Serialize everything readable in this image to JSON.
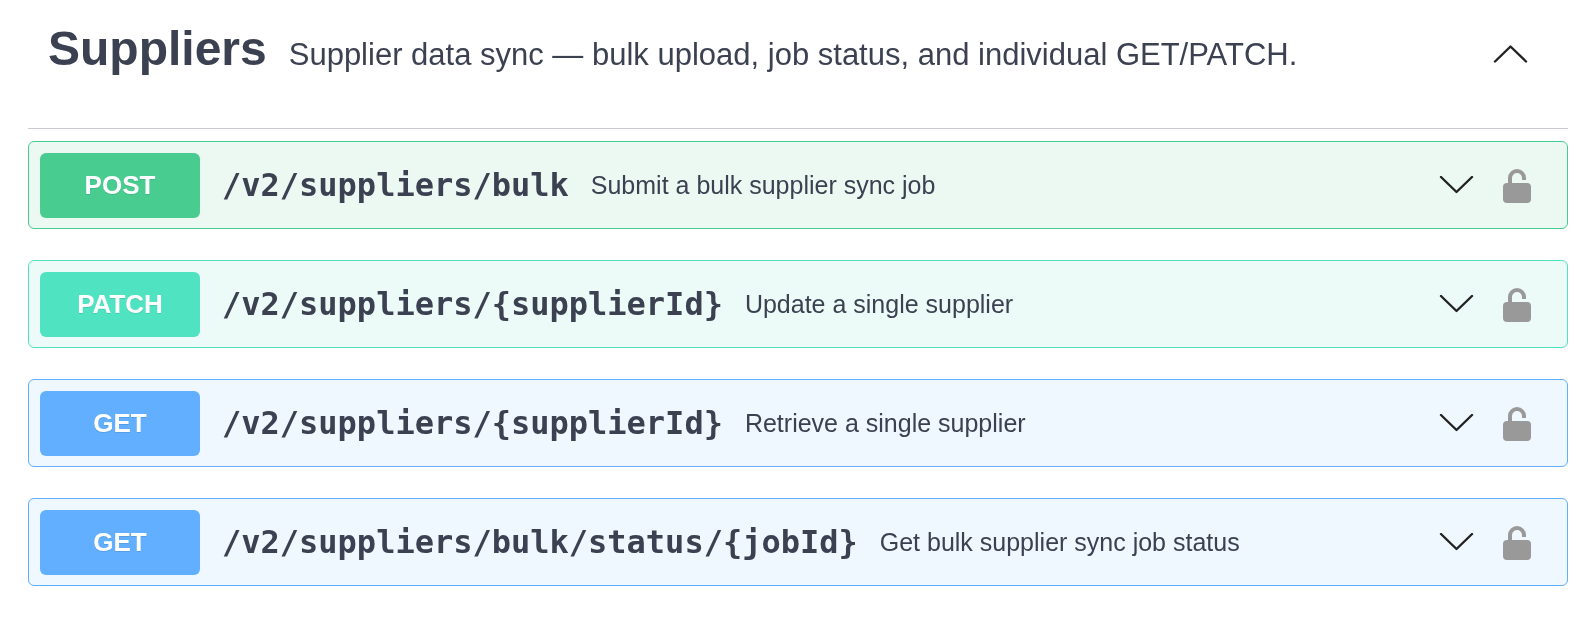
{
  "section": {
    "title": "Suppliers",
    "description": "Supplier data sync — bulk upload, job status, and individual GET/PATCH.",
    "expanded": true
  },
  "operations": [
    {
      "kind": "post",
      "method": "POST",
      "path": "/v2/suppliers/bulk",
      "summary": "Submit a bulk supplier sync job",
      "expanded": false,
      "locked": false
    },
    {
      "kind": "patch",
      "method": "PATCH",
      "path": "/v2/suppliers/{supplierId}",
      "summary": "Update a single supplier",
      "expanded": false,
      "locked": false
    },
    {
      "kind": "get",
      "method": "GET",
      "path": "/v2/suppliers/{supplierId}",
      "summary": "Retrieve a single supplier",
      "expanded": false,
      "locked": false
    },
    {
      "kind": "get",
      "method": "GET",
      "path": "/v2/suppliers/bulk/status/{jobId}",
      "summary": "Get bulk supplier sync job status",
      "expanded": false,
      "locked": false
    }
  ]
}
